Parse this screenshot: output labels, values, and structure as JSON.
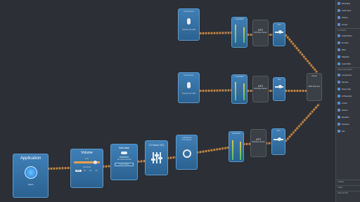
{
  "app": {
    "nodes": {
      "application": {
        "title": "Application",
        "source": "Safari"
      },
      "volume": {
        "title": "Volume",
        "value": "100",
        "overdrive": "Overdrive",
        "buttons": [
          "OFF",
          "2X",
          "3X",
          "4X"
        ]
      },
      "denoise": {
        "title": "Denoise",
        "state": "Inactive",
        "note": "No noise learned",
        "learn": "Learn Noise"
      },
      "eq": {
        "title": "10 Band EQ"
      },
      "compressor": {
        "title": "4-Multiband Compressor"
      },
      "input1": {
        "title": "Input Device",
        "device": "Scarlett 2i2 USB"
      },
      "input2": {
        "title": "Input Device",
        "device": "Scarlett 2i2 USB"
      },
      "peak_label": "Peak/RMS",
      "mp3_label": "MP3",
      "mp3_detail": "128 kbps Stereo",
      "pan_label": "Pan",
      "output": {
        "title": "Output",
        "detail": "MP3 Still Here"
      }
    },
    "sidebar": {
      "sections": [
        {
          "header": "",
          "items": [
            "Recording",
            "Audio Input",
            "Volume",
            "Format"
          ]
        },
        {
          "header": "FILTERS",
          "items": [
            "Output Mixer",
            "Function",
            "Pitch",
            "Playback",
            "Level Rider"
          ]
        },
        {
          "header": "PROCESSORS",
          "items": [
            "Compressor",
            "Denoise",
            "Noise Gate",
            "10 Band EQ",
            "Limiter",
            "Volume",
            "Equalizer",
            "De-Esser",
            "Pan"
          ]
        }
      ],
      "footers": [
        "SHARE",
        "OPEN",
        "ADD FILTER"
      ]
    }
  }
}
